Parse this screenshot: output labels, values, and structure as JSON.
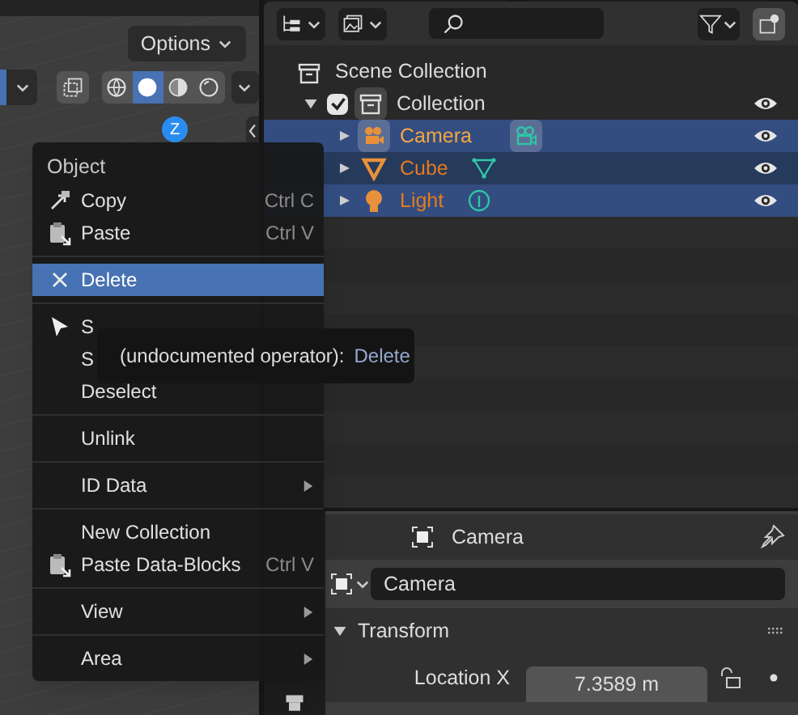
{
  "viewport": {
    "options_button": "Options",
    "shading_modes": [
      {
        "selected": false
      },
      {
        "selected": true
      },
      {
        "selected": false
      },
      {
        "selected": false
      }
    ],
    "gizmo_axis": "Z"
  },
  "outliner": {
    "rows": [
      {
        "label": "Scene Collection",
        "kind": "scene",
        "children": [
          {
            "label": "Collection",
            "kind": "collection",
            "checked": true,
            "selected": false,
            "children": [
              {
                "label": "Camera",
                "kind": "camera",
                "selected": true,
                "active": true
              },
              {
                "label": "Cube",
                "kind": "mesh",
                "selected": true,
                "active": false
              },
              {
                "label": "Light",
                "kind": "light",
                "selected": true,
                "active": false
              }
            ]
          }
        ]
      }
    ]
  },
  "context_menu": {
    "title": "Object",
    "items": [
      {
        "kind": "item",
        "label": "Copy",
        "shortcut": "Ctrl C",
        "selected": false
      },
      {
        "kind": "item",
        "label": "Paste",
        "shortcut": "Ctrl V",
        "selected": false
      },
      {
        "kind": "separator"
      },
      {
        "kind": "item",
        "label": "Delete",
        "selected": true
      },
      {
        "kind": "separator"
      },
      {
        "kind": "item",
        "label": "S",
        "selected": false
      },
      {
        "kind": "item",
        "label": "S",
        "selected": false
      },
      {
        "kind": "item",
        "label": "Deselect",
        "selected": false
      },
      {
        "kind": "separator"
      },
      {
        "kind": "item",
        "label": "Unlink",
        "selected": false
      },
      {
        "kind": "separator"
      },
      {
        "kind": "submenu",
        "label": "ID Data",
        "selected": false
      },
      {
        "kind": "separator"
      },
      {
        "kind": "item",
        "label": "New Collection",
        "selected": false
      },
      {
        "kind": "item",
        "label": "Paste Data-Blocks",
        "shortcut": "Ctrl V",
        "selected": false
      },
      {
        "kind": "separator"
      },
      {
        "kind": "submenu",
        "label": "View",
        "selected": false
      },
      {
        "kind": "separator"
      },
      {
        "kind": "submenu",
        "label": "Area",
        "selected": false
      }
    ]
  },
  "tooltip": {
    "text": "(undocumented operator):",
    "operator": "Delete"
  },
  "properties": {
    "header": "Camera",
    "name_field": "Camera",
    "panel": {
      "title": "Transform",
      "expanded": true
    },
    "fields": [
      {
        "label": "Location X",
        "value": "7.3589 m"
      }
    ]
  }
}
